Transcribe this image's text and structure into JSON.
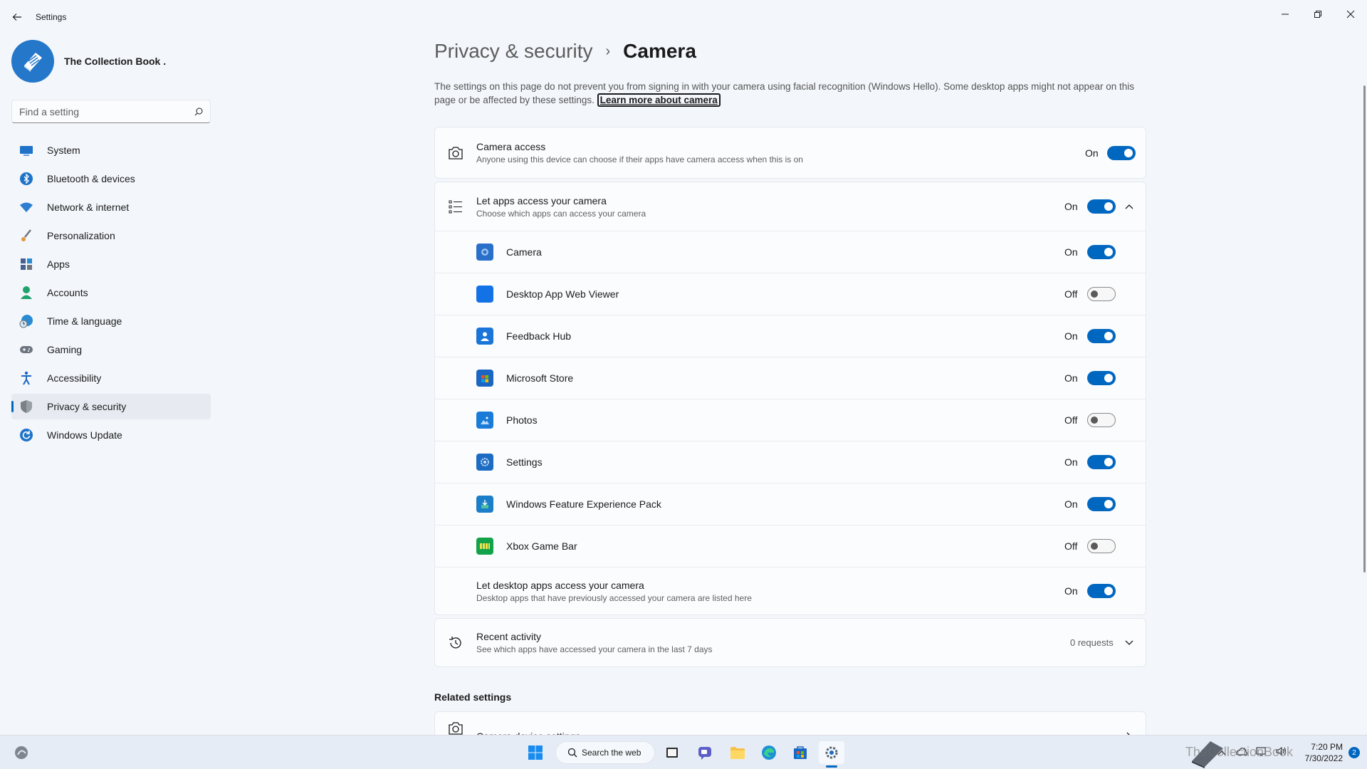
{
  "window": {
    "title": "Settings"
  },
  "profile": {
    "name": "The Collection Book ."
  },
  "search": {
    "placeholder": "Find a setting"
  },
  "sidebar": {
    "items": [
      {
        "label": "System",
        "icon": "system-icon",
        "color": "#1e73c8"
      },
      {
        "label": "Bluetooth & devices",
        "icon": "bluetooth-icon",
        "color": "#1e73c8"
      },
      {
        "label": "Network & internet",
        "icon": "wifi-icon",
        "color": "#2f7dd1"
      },
      {
        "label": "Personalization",
        "icon": "brush-icon",
        "color": "#d08a36"
      },
      {
        "label": "Apps",
        "icon": "apps-icon",
        "color": "#46608f"
      },
      {
        "label": "Accounts",
        "icon": "person-icon",
        "color": "#1fa26b"
      },
      {
        "label": "Time & language",
        "icon": "globe-clock-icon",
        "color": "#2a8bd1"
      },
      {
        "label": "Gaming",
        "icon": "gamepad-icon",
        "color": "#6d7680"
      },
      {
        "label": "Accessibility",
        "icon": "accessibility-icon",
        "color": "#1a66c2"
      },
      {
        "label": "Privacy & security",
        "icon": "shield-icon",
        "color": "#7a8088"
      },
      {
        "label": "Windows Update",
        "icon": "update-icon",
        "color": "#1e73c8"
      }
    ],
    "active_index": 9
  },
  "breadcrumb": {
    "parent": "Privacy & security",
    "separator": "›",
    "current": "Camera"
  },
  "description": {
    "text": "The settings on this page do not prevent you from signing in with your camera using facial recognition (Windows Hello). Some desktop apps might not appear on this page or be affected by these settings.",
    "link": "Learn more about camera"
  },
  "camera_access": {
    "title": "Camera access",
    "subtitle": "Anyone using this device can choose if their apps have camera access when this is on",
    "state": "On"
  },
  "apps_access": {
    "title": "Let apps access your camera",
    "subtitle": "Choose which apps can access your camera",
    "state": "On",
    "apps": [
      {
        "name": "Camera",
        "state": "On",
        "icon": "camera-app-icon",
        "color": "#2a6fc9"
      },
      {
        "name": "Desktop App Web Viewer",
        "state": "Off",
        "icon": "web-viewer-icon",
        "color": "#1373e6"
      },
      {
        "name": "Feedback Hub",
        "state": "On",
        "icon": "feedback-hub-icon",
        "color": "#1b75d9"
      },
      {
        "name": "Microsoft Store",
        "state": "On",
        "icon": "store-icon",
        "color": "#1a66c2"
      },
      {
        "name": "Photos",
        "state": "Off",
        "icon": "photos-icon",
        "color": "#1b7bd8"
      },
      {
        "name": "Settings",
        "state": "On",
        "icon": "settings-app-icon",
        "color": "#1d6cc4"
      },
      {
        "name": "Windows Feature Experience Pack",
        "state": "On",
        "icon": "feature-pack-icon",
        "color": "#1a7ec8"
      },
      {
        "name": "Xbox Game Bar",
        "state": "Off",
        "icon": "xbox-icon",
        "color": "#12a34a"
      }
    ],
    "desktop": {
      "title": "Let desktop apps access your camera",
      "subtitle": "Desktop apps that have previously accessed your camera are listed here",
      "state": "On"
    }
  },
  "recent_activity": {
    "title": "Recent activity",
    "subtitle": "See which apps have accessed your camera in the last 7 days",
    "value": "0 requests"
  },
  "related": {
    "heading": "Related settings",
    "items": [
      {
        "title": "Camera device settings"
      }
    ]
  },
  "taskbar": {
    "search_label": "Search the web",
    "time": "7:20 PM",
    "date": "7/30/2022",
    "notifications": "2",
    "watermark": "TheCollectionBook"
  }
}
